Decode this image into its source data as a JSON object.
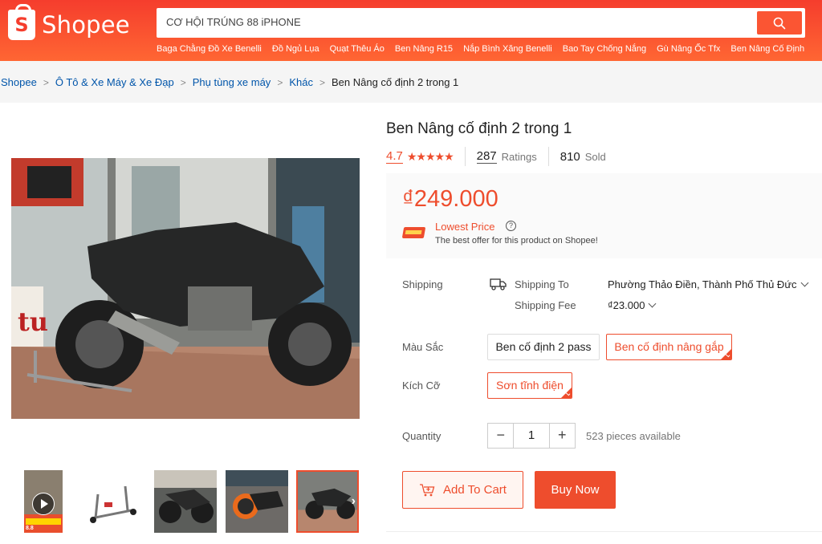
{
  "header": {
    "logo_text": "Shopee",
    "logo_letter": "S",
    "search_value": "CƠ HỘI TRÚNG 88 iPHONE",
    "keywords": [
      "Baga Chằng Đồ Xe Benelli",
      "Đồ Ngủ Lụa",
      "Quạt Thêu Áo",
      "Ben Nâng R15",
      "Nắp Bình Xăng Benelli",
      "Bao Tay Chống Nắng",
      "Gù Nâng Ốc Tfx",
      "Ben Nâng Cố Định"
    ]
  },
  "breadcrumb": [
    "Shopee",
    "Ô Tô & Xe Máy & Xe Đạp",
    "Phụ tùng xe máy",
    "Khác",
    "Ben Nâng cố định 2 trong 1"
  ],
  "product": {
    "title": "Ben Nâng cố định 2 trong 1",
    "rating": "4.7",
    "stars": "★★★★★",
    "ratings_count": "287",
    "ratings_label": "Ratings",
    "sold_count": "810",
    "sold_label": "Sold",
    "price": "₫249.000",
    "lowest_price_label": "Lowest Price",
    "lowest_price_sub": "The best offer for this product on Shopee!"
  },
  "shipping": {
    "label": "Shipping",
    "to_label": "Shipping To",
    "to_value": "Phường Thảo Điền, Thành Phố Thủ Đức",
    "fee_label": "Shipping Fee",
    "fee_value": "₫23.000"
  },
  "variations": {
    "color_label": "Màu Sắc",
    "color_options": [
      "Ben cố định 2 pass",
      "Ben cố định nâng gắp"
    ],
    "color_selected": 1,
    "size_label": "Kích Cỡ",
    "size_options": [
      "Sơn tĩnh điện"
    ],
    "size_selected": 0
  },
  "quantity": {
    "label": "Quantity",
    "value": "1",
    "minus": "−",
    "plus": "+",
    "available": "523 pieces available"
  },
  "actions": {
    "add_to_cart": "Add To Cart",
    "buy_now": "Buy Now"
  },
  "gallery": {
    "thumb_badge": "8.8"
  },
  "colors": {
    "brand": "#ee4d2d",
    "header_top": "#f53d2d",
    "header_bottom": "#ff6633",
    "link": "#0055aa"
  }
}
